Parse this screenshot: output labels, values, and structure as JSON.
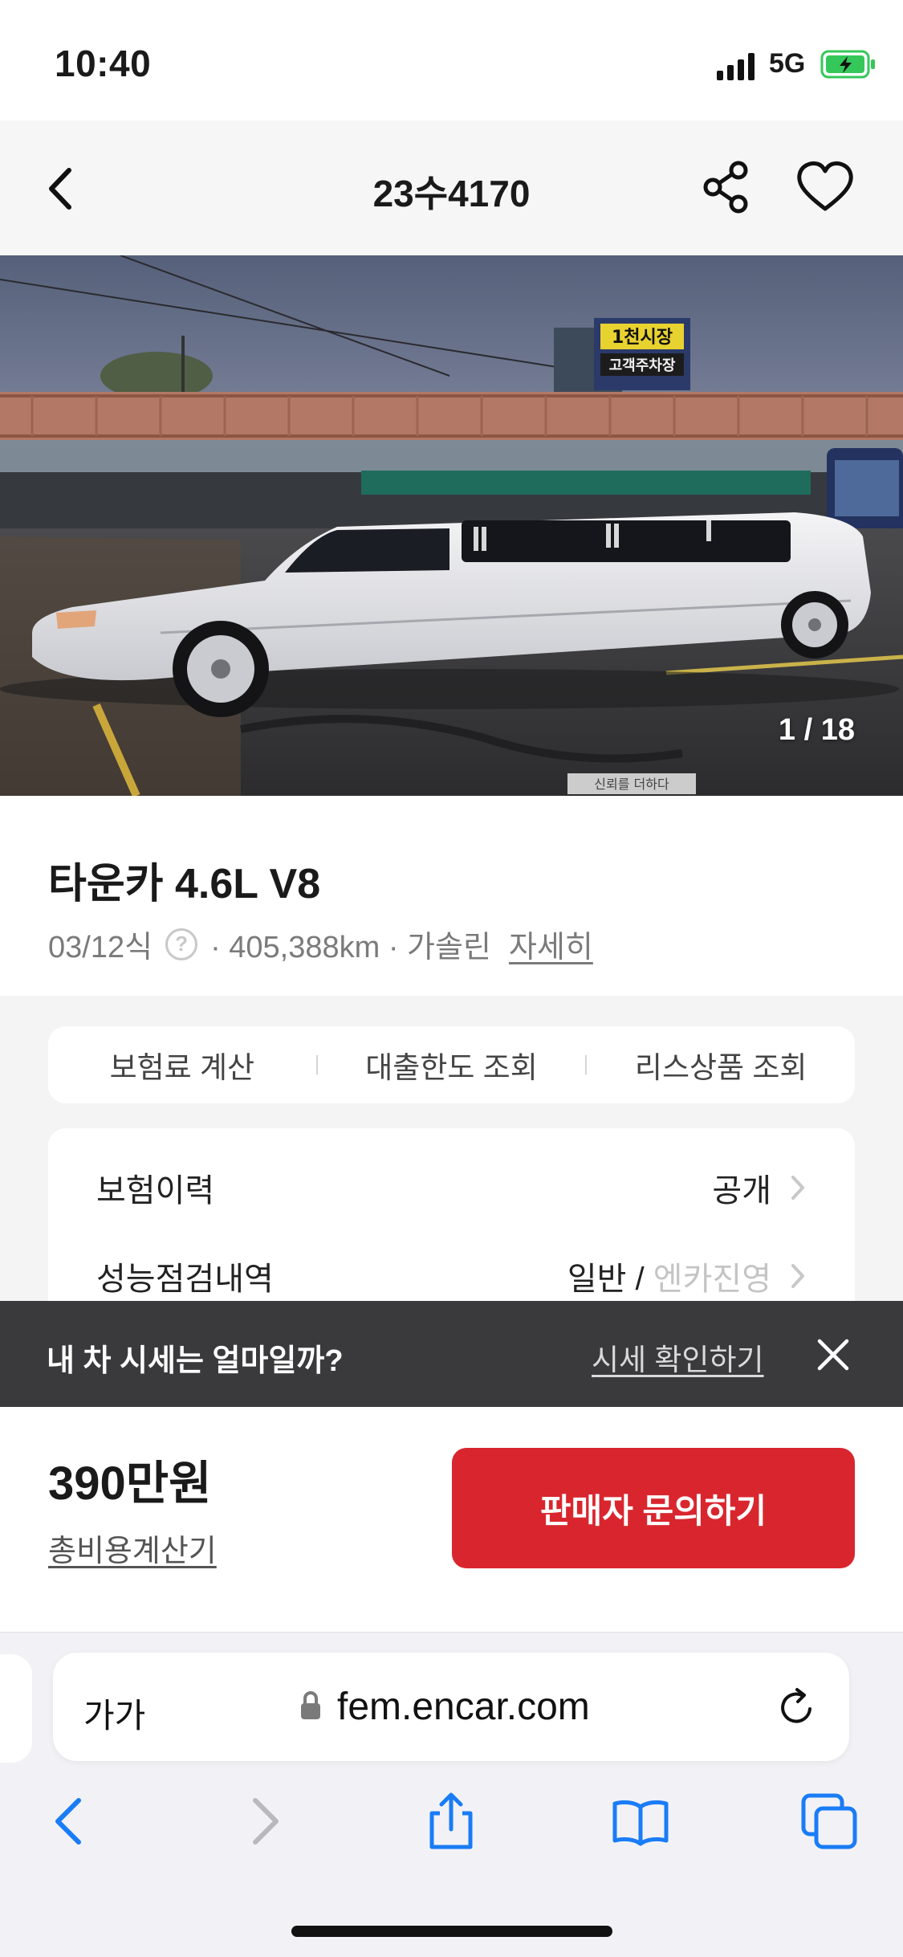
{
  "status_bar": {
    "time": "10:40",
    "network": "5G"
  },
  "header": {
    "title": "23수4170"
  },
  "photo": {
    "counter": "1 / 18",
    "sign_top": "1천시장",
    "sign_bottom": "고객주차장",
    "watermark": "신뢰를 더하다"
  },
  "car": {
    "title": "타운카 4.6L V8",
    "year": "03/12식",
    "mileage": "· 405,388km · 가솔린",
    "detail_link": "자세히"
  },
  "actions": [
    {
      "label": "보험료 계산"
    },
    {
      "label": "대출한도 조회"
    },
    {
      "label": "리스상품 조회"
    }
  ],
  "history": {
    "insurance_label": "보험이력",
    "insurance_value": "공개",
    "inspection_label": "성능점검내역",
    "inspection_value": "일반 /",
    "inspection_value_muted": "엔카진영"
  },
  "banner": {
    "text": "내 차 시세는 얼마일까?",
    "link": "시세 확인하기"
  },
  "price": {
    "value": "390만원",
    "calc_link": "총비용계산기",
    "cta": "판매자 문의하기"
  },
  "browser": {
    "text_size": "가가",
    "url": "fem.encar.com"
  },
  "colors": {
    "accent": "#d9262e",
    "banner_bg": "#3a3a3c",
    "battery_green": "#34c759",
    "safari_blue": "#1a7cf6"
  }
}
